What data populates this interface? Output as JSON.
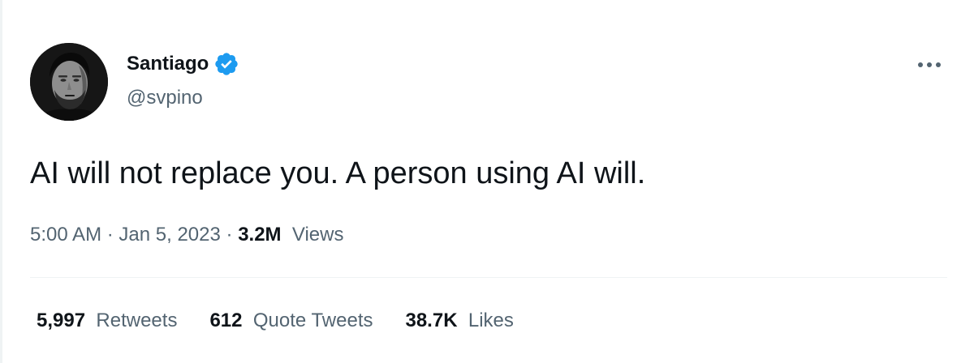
{
  "author": {
    "display_name": "Santiago",
    "handle": "@svpino",
    "verified": true,
    "verified_color": "#1d9bf0"
  },
  "tweet": {
    "text": "AI will not replace you. A person using AI will.",
    "time": "5:00 AM",
    "separator": "·",
    "date": "Jan 5, 2023",
    "views_count": "3.2M",
    "views_label": "Views"
  },
  "stats": {
    "retweets": {
      "count": "5,997",
      "label": "Retweets"
    },
    "quotes": {
      "count": "612",
      "label": "Quote Tweets"
    },
    "likes": {
      "count": "38.7K",
      "label": "Likes"
    }
  },
  "icons": {
    "more": "more-horizontal-icon",
    "verified": "verified-badge-icon"
  }
}
